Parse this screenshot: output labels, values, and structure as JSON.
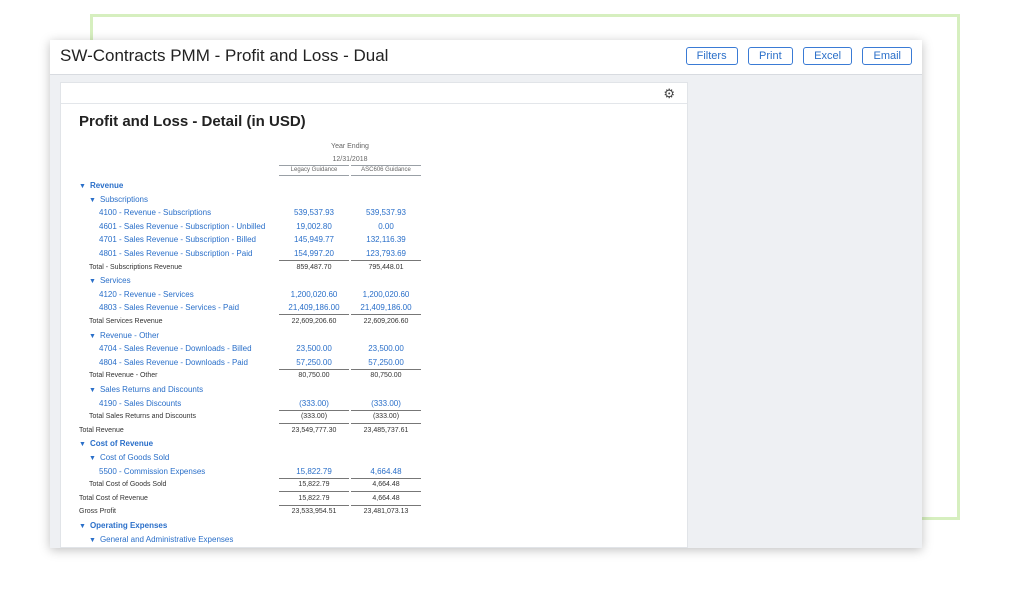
{
  "window": {
    "title": "SW-Contracts PMM - Profit and Loss - Dual",
    "buttons": [
      "Filters",
      "Print",
      "Excel",
      "Email"
    ]
  },
  "report": {
    "title": "Profit and Loss - Detail (in USD)",
    "period_label": "Year Ending",
    "period_date": "12/31/2018",
    "columns": [
      "Legacy Guidance",
      "ASC606 Guidance"
    ],
    "rows": [
      {
        "type": "section",
        "label": "Revenue"
      },
      {
        "type": "subsection",
        "label": "Subscriptions"
      },
      {
        "type": "account",
        "label": "4100 - Revenue - Subscriptions",
        "v1": "539,537.93",
        "v2": "539,537.93"
      },
      {
        "type": "account",
        "label": "4601 - Sales Revenue - Subscription - Unbilled",
        "v1": "19,002.80",
        "v2": "0.00"
      },
      {
        "type": "account",
        "label": "4701 - Sales Revenue - Subscription - Billed",
        "v1": "145,949.77",
        "v2": "132,116.39"
      },
      {
        "type": "account",
        "label": "4801 - Sales Revenue - Subscription - Paid",
        "v1": "154,997.20",
        "v2": "123,793.69"
      },
      {
        "type": "total",
        "level": 1,
        "label": "Total - Subscriptions Revenue",
        "v1": "859,487.70",
        "v2": "795,448.01"
      },
      {
        "type": "subsection",
        "label": "Services"
      },
      {
        "type": "account",
        "label": "4120 - Revenue - Services",
        "v1": "1,200,020.60",
        "v2": "1,200,020.60"
      },
      {
        "type": "account",
        "label": "4803 - Sales Revenue - Services - Paid",
        "v1": "21,409,186.00",
        "v2": "21,409,186.00"
      },
      {
        "type": "total",
        "level": 1,
        "label": "Total Services Revenue",
        "v1": "22,609,206.60",
        "v2": "22,609,206.60"
      },
      {
        "type": "subsection",
        "label": "Revenue - Other"
      },
      {
        "type": "account",
        "label": "4704 - Sales Revenue - Downloads - Billed",
        "v1": "23,500.00",
        "v2": "23,500.00"
      },
      {
        "type": "account",
        "label": "4804 - Sales Revenue - Downloads - Paid",
        "v1": "57,250.00",
        "v2": "57,250.00"
      },
      {
        "type": "total",
        "level": 1,
        "label": "Total Revenue - Other",
        "v1": "80,750.00",
        "v2": "80,750.00"
      },
      {
        "type": "subsection",
        "label": "Sales Returns and Discounts"
      },
      {
        "type": "account",
        "label": "4190 - Sales Discounts",
        "v1": "(333.00)",
        "v2": "(333.00)"
      },
      {
        "type": "total",
        "level": 1,
        "label": "Total Sales Returns and Discounts",
        "v1": "(333.00)",
        "v2": "(333.00)"
      },
      {
        "type": "total",
        "level": 0,
        "label": "Total Revenue",
        "v1": "23,549,777.30",
        "v2": "23,485,737.61"
      },
      {
        "type": "section",
        "label": "Cost of Revenue"
      },
      {
        "type": "subsection",
        "label": "Cost of Goods Sold"
      },
      {
        "type": "account",
        "label": "5500 - Commission Expenses",
        "v1": "15,822.79",
        "v2": "4,664.48"
      },
      {
        "type": "total",
        "level": 1,
        "label": "Total Cost of Goods Sold",
        "v1": "15,822.79",
        "v2": "4,664.48"
      },
      {
        "type": "total",
        "level": 0,
        "label": "Total Cost of Revenue",
        "v1": "15,822.79",
        "v2": "4,664.48"
      },
      {
        "type": "total",
        "level": 0,
        "label": "Gross Profit",
        "v1": "23,533,954.51",
        "v2": "23,481,073.13"
      },
      {
        "type": "section",
        "label": "Operating Expenses"
      },
      {
        "type": "subsection",
        "label": "General and Administrative Expenses"
      }
    ]
  },
  "icons": {
    "settings": "gear-icon",
    "expand": "triangle-down-icon"
  },
  "colors": {
    "accent": "#2a6fc9",
    "frame": "#d6efbf"
  }
}
